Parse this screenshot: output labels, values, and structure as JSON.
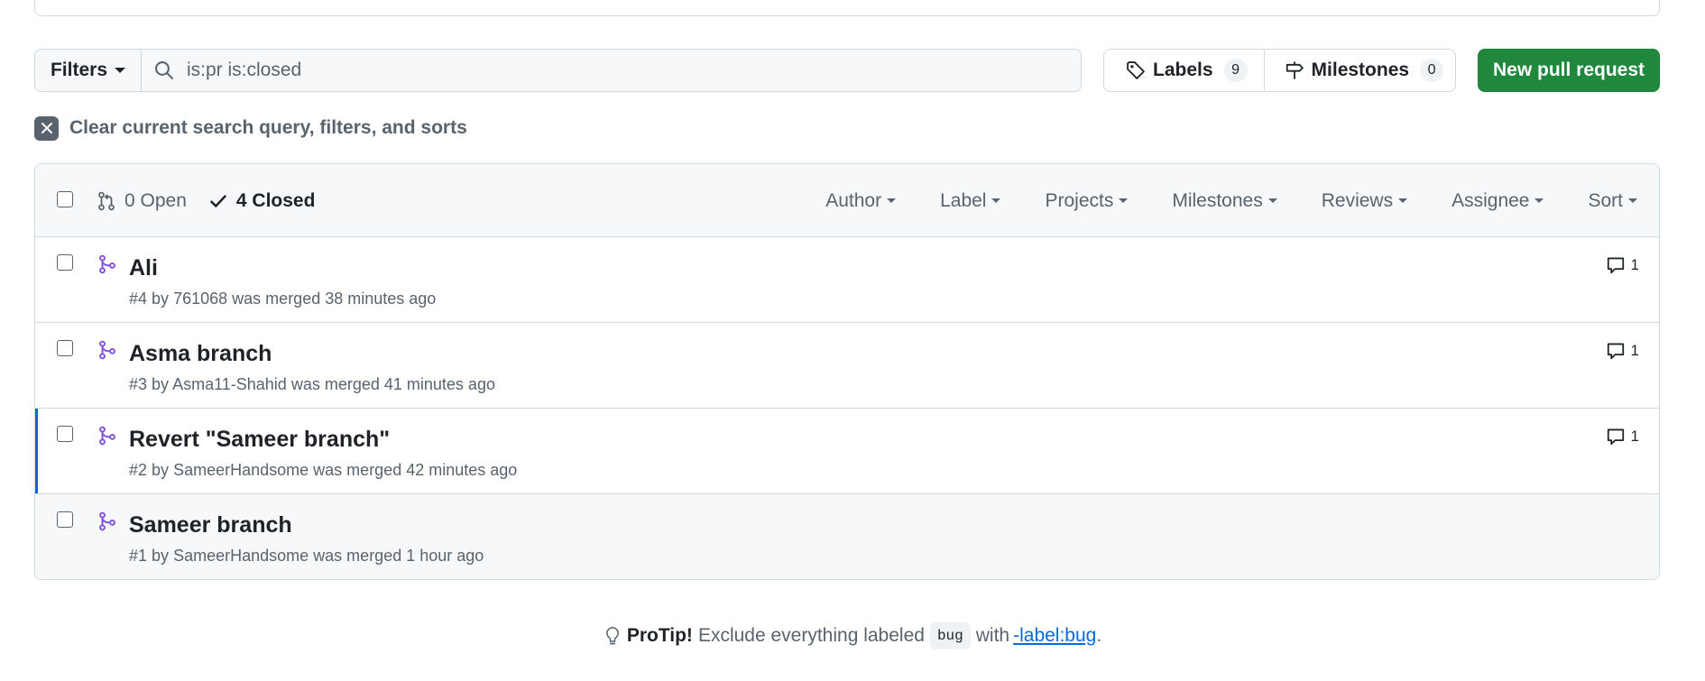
{
  "toolbar": {
    "filters_label": "Filters",
    "search_value": "is:pr is:closed",
    "labels_label": "Labels",
    "labels_count": "9",
    "milestones_label": "Milestones",
    "milestones_count": "0",
    "new_pr_label": "New pull request"
  },
  "clear": {
    "label": "Clear current search query, filters, and sorts"
  },
  "list_header": {
    "open_label": "0 Open",
    "closed_label": "4 Closed",
    "filters": [
      "Author",
      "Label",
      "Projects",
      "Milestones",
      "Reviews",
      "Assignee",
      "Sort"
    ]
  },
  "pull_requests": [
    {
      "title": "Ali",
      "number": "#4",
      "by": "by",
      "author": "761068",
      "status": "was merged 38 minutes ago",
      "comments": "1"
    },
    {
      "title": "Asma branch",
      "number": "#3",
      "by": "by",
      "author": "Asma11-Shahid",
      "status": "was merged 41 minutes ago",
      "comments": "1"
    },
    {
      "title": "Revert \"Sameer branch\"",
      "number": "#2",
      "by": "by",
      "author": "SameerHandsome",
      "status": "was merged 42 minutes ago",
      "comments": "1"
    },
    {
      "title": "Sameer branch",
      "number": "#1",
      "by": "by",
      "author": "SameerHandsome",
      "status": "was merged 1 hour ago",
      "comments": ""
    }
  ],
  "protip": {
    "strong": "ProTip!",
    "text_before": "Exclude everything labeled",
    "code": "bug",
    "text_mid": "with",
    "link": "-label:bug",
    "text_after": "."
  },
  "colors": {
    "primary_button": "#1f883d",
    "merged_icon": "#8250df",
    "link": "#0969da",
    "highlight_bar": "#0969da"
  },
  "icons": [
    "search-icon",
    "tag-icon",
    "milestone-icon",
    "x-icon",
    "pull-request-icon",
    "check-icon",
    "merged-icon",
    "comment-icon",
    "light-bulb-icon"
  ]
}
